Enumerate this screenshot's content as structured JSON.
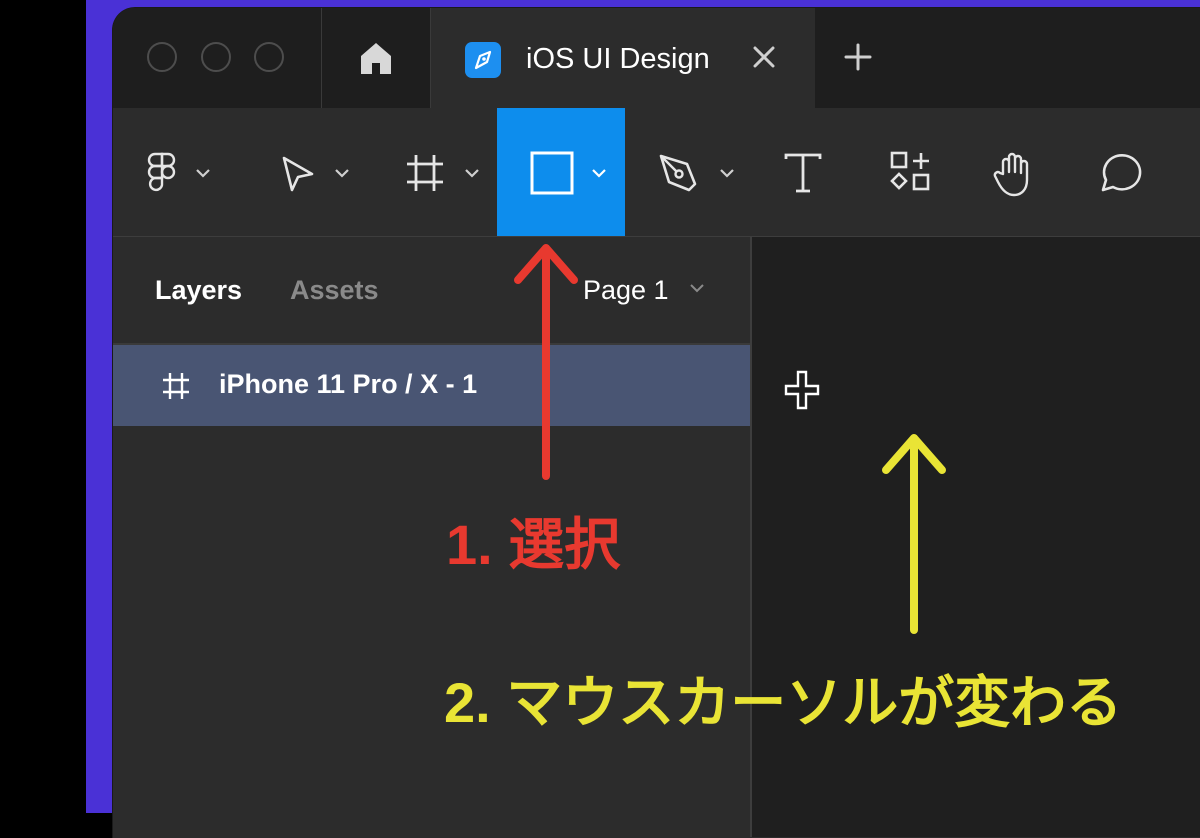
{
  "tab": {
    "title": "iOS UI Design"
  },
  "panel": {
    "tabs": [
      "Layers",
      "Assets"
    ],
    "page_select": "Page 1",
    "layers": [
      {
        "name": "iPhone 11 Pro / X - 1"
      }
    ]
  },
  "annotations": {
    "step1": "1. 選択",
    "step2": "2. マウスカーソルが変わる"
  },
  "colors": {
    "active_tool": "#0d8ded",
    "selected_layer": "#495573",
    "annotation_red": "#e8392f",
    "annotation_yellow": "#e9e435",
    "background_accent": "#4a31d6"
  },
  "icons": {
    "toolbar": [
      "figma-menu-icon",
      "move-tool-icon",
      "frame-tool-icon",
      "rectangle-tool-icon",
      "pen-tool-icon",
      "text-tool-icon",
      "resources-icon",
      "hand-tool-icon",
      "comment-icon"
    ],
    "tabbar": [
      "home-icon",
      "file-logo-icon",
      "close-icon",
      "plus-icon"
    ]
  }
}
